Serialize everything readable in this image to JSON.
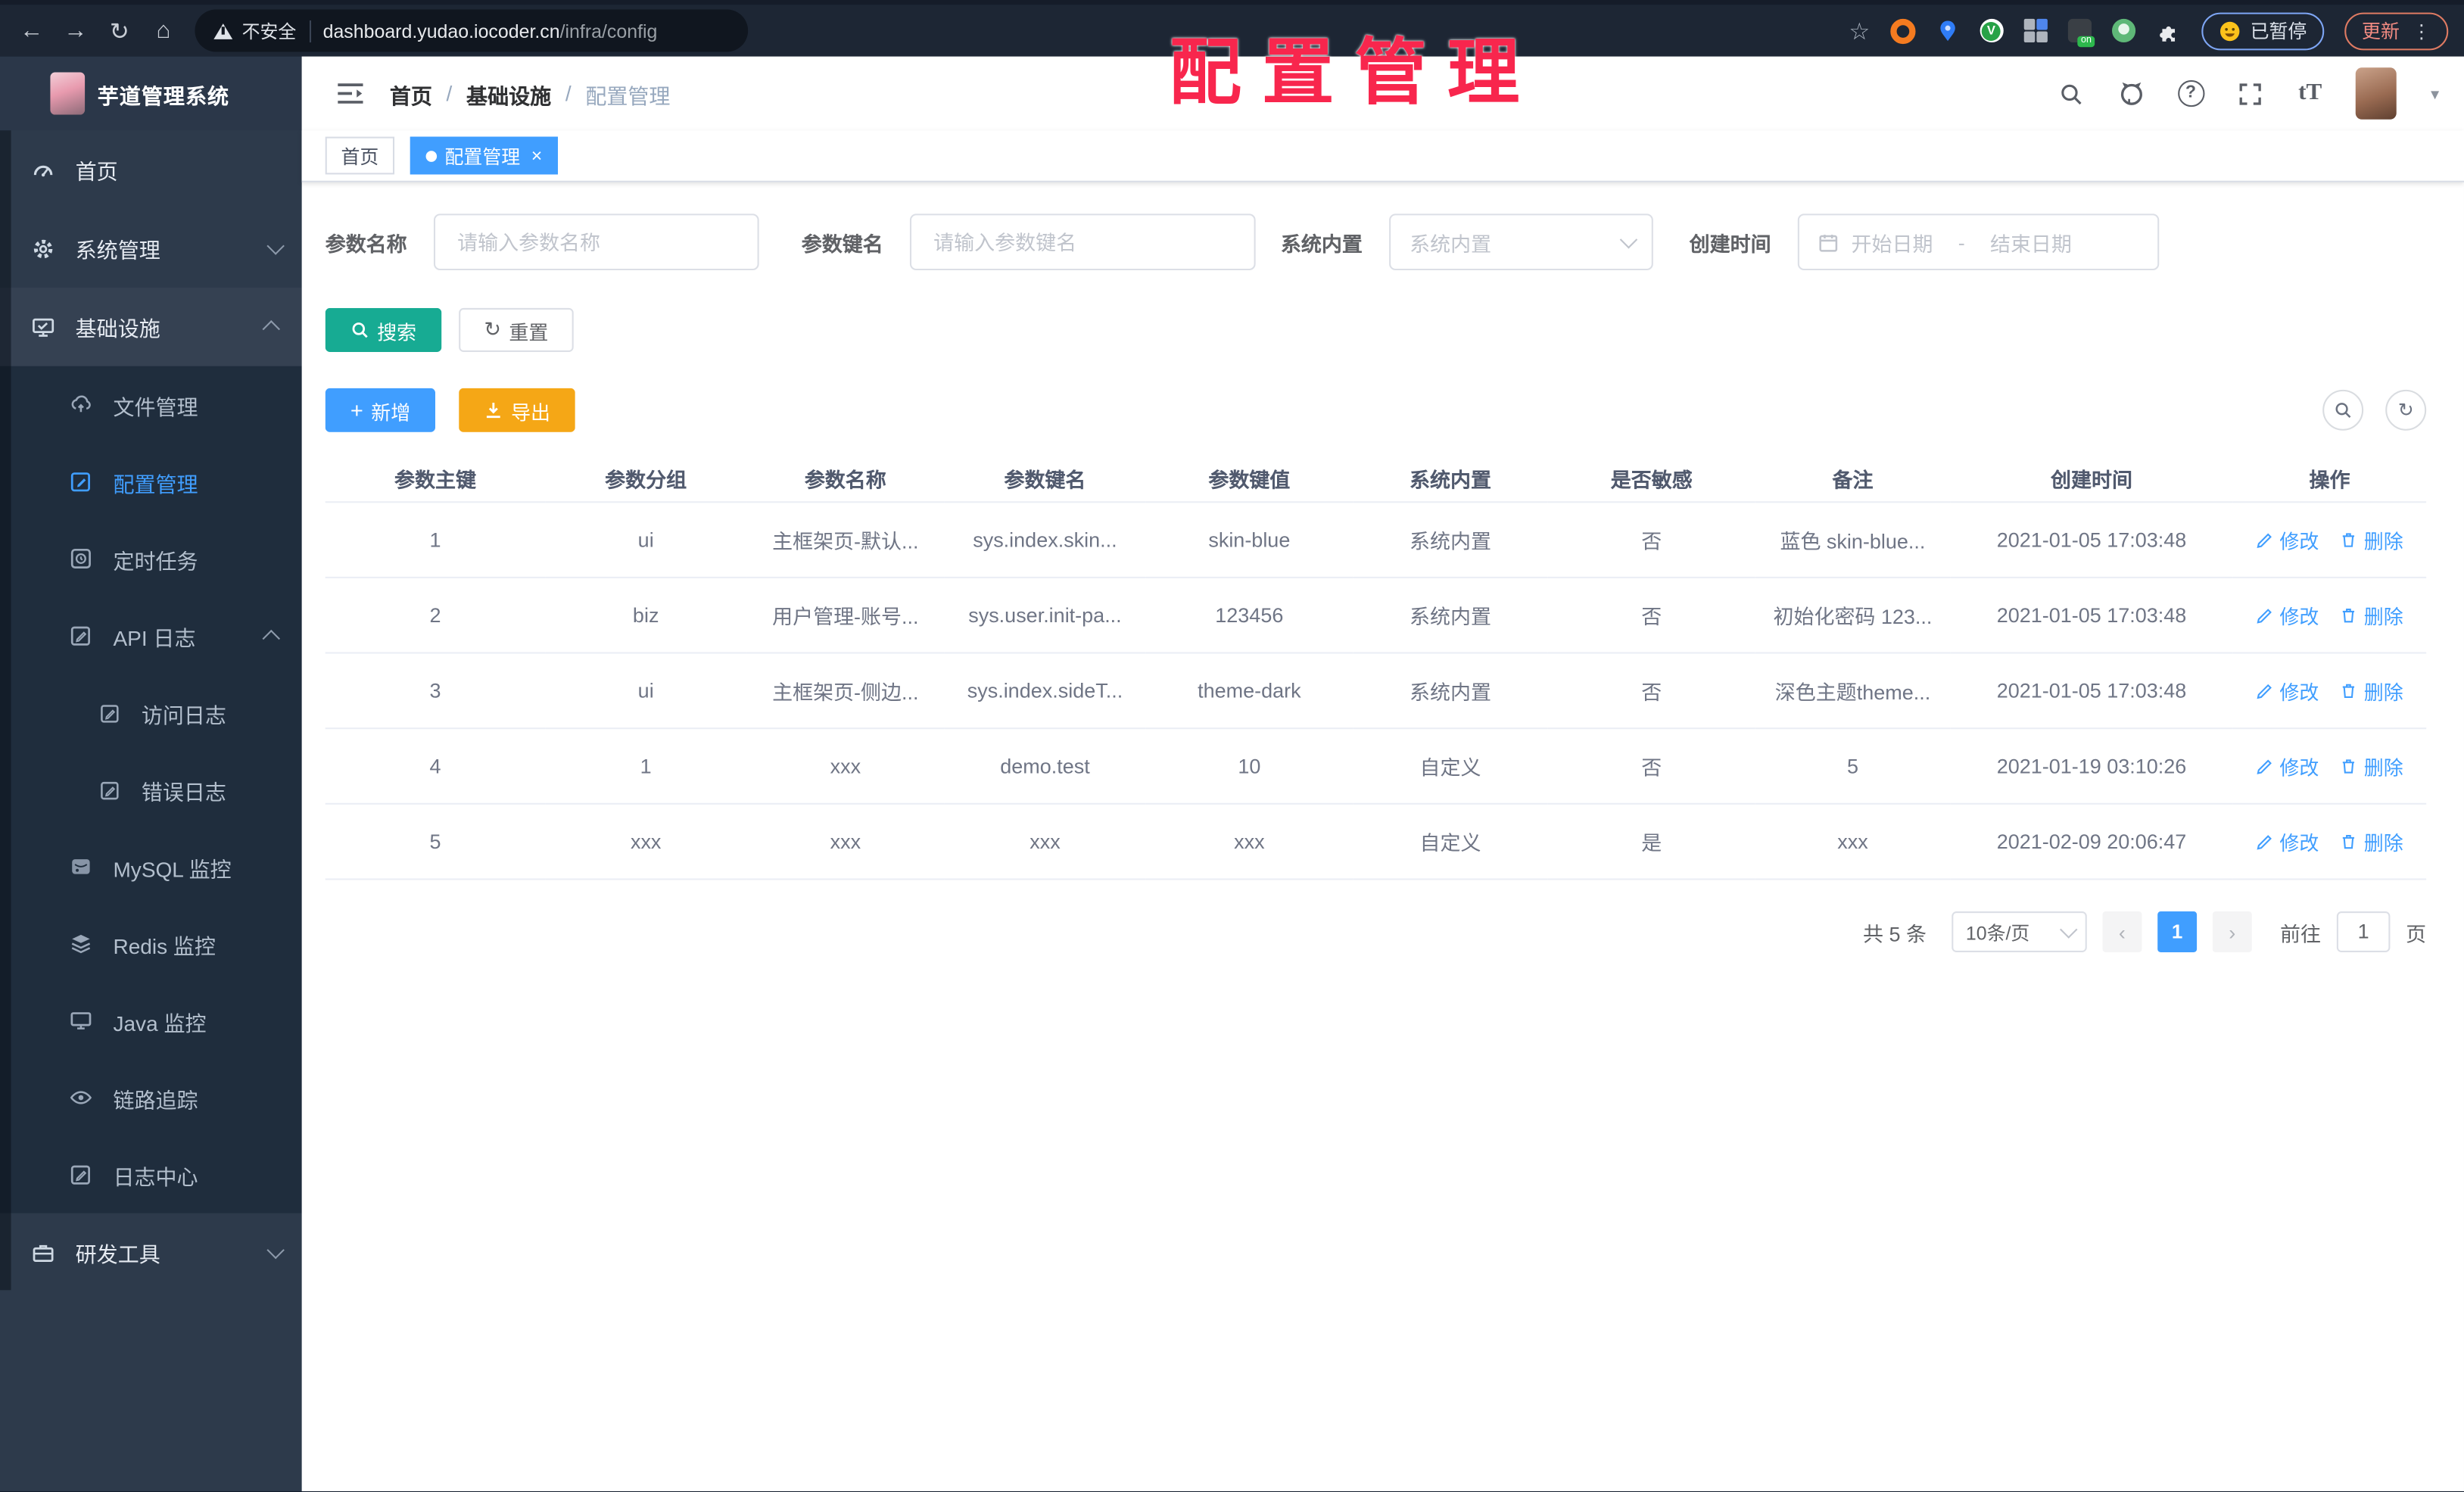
{
  "colors": {
    "accent": "#409eff",
    "search_button": "#17ab93",
    "export_button": "#f5a716",
    "watermark_red": "#f8264d",
    "sidebar_bg": "#2d3a4b",
    "submenu_bg": "#1f2d3d"
  },
  "watermark": "配置管理",
  "browser": {
    "not_secure": "不安全",
    "url_host": "dashboard.yudao.iocoder.cn",
    "url_path": "/infra/config",
    "paused_label": "已暂停",
    "update_label": "更新"
  },
  "sidebar": {
    "title": "芋道管理系统",
    "items": [
      {
        "label": "首页",
        "icon": "dashboard-icon"
      },
      {
        "label": "系统管理",
        "icon": "gear-icon",
        "chevron": "down"
      },
      {
        "label": "基础设施",
        "icon": "infra-monitor-icon",
        "chevron": "up"
      },
      {
        "label": "文件管理",
        "icon": "cloud-upload-icon"
      },
      {
        "label": "配置管理",
        "icon": "edit-square-icon",
        "active": true
      },
      {
        "label": "定时任务",
        "icon": "timer-icon"
      },
      {
        "label": "API 日志",
        "icon": "log-edit-icon",
        "chevron": "up"
      },
      {
        "label": "访问日志",
        "icon": "log-edit-icon"
      },
      {
        "label": "错误日志",
        "icon": "log-edit-icon"
      },
      {
        "label": "MySQL 监控",
        "icon": "database-icon"
      },
      {
        "label": "Redis 监控",
        "icon": "layers-icon"
      },
      {
        "label": "Java 监控",
        "icon": "monitor-icon"
      },
      {
        "label": "链路追踪",
        "icon": "eye-icon"
      },
      {
        "label": "日志中心",
        "icon": "log-edit-icon"
      },
      {
        "label": "研发工具",
        "icon": "briefcase-icon",
        "chevron": "down"
      }
    ]
  },
  "topbar": {
    "breadcrumb": {
      "home": "首页",
      "section": "基础设施",
      "current": "配置管理"
    }
  },
  "tags": {
    "home": "首页",
    "current": "配置管理"
  },
  "filters": {
    "name_label": "参数名称",
    "name_placeholder": "请输入参数名称",
    "key_label": "参数键名",
    "key_placeholder": "请输入参数键名",
    "type_label": "系统内置",
    "type_placeholder": "系统内置",
    "date_label": "创建时间",
    "date_start": "开始日期",
    "date_sep": "-",
    "date_end": "结束日期",
    "search": "搜索",
    "reset": "重置"
  },
  "toolbar": {
    "add": "新增",
    "export": "导出"
  },
  "table": {
    "columns": [
      "参数主键",
      "参数分组",
      "参数名称",
      "参数键名",
      "参数键值",
      "系统内置",
      "是否敏感",
      "备注",
      "创建时间",
      "操作"
    ],
    "rows": [
      {
        "cells": [
          "1",
          "ui",
          "主框架页-默认...",
          "sys.index.skin...",
          "skin-blue",
          "系统内置",
          "否",
          "蓝色 skin-blue...",
          "2021-01-05 17:03:48"
        ],
        "edit": "修改",
        "delete": "删除"
      },
      {
        "cells": [
          "2",
          "biz",
          "用户管理-账号...",
          "sys.user.init-pa...",
          "123456",
          "系统内置",
          "否",
          "初始化密码 123...",
          "2021-01-05 17:03:48"
        ],
        "edit": "修改",
        "delete": "删除"
      },
      {
        "cells": [
          "3",
          "ui",
          "主框架页-侧边...",
          "sys.index.sideT...",
          "theme-dark",
          "系统内置",
          "否",
          "深色主题theme...",
          "2021-01-05 17:03:48"
        ],
        "edit": "修改",
        "delete": "删除"
      },
      {
        "cells": [
          "4",
          "1",
          "xxx",
          "demo.test",
          "10",
          "自定义",
          "否",
          "5",
          "2021-01-19 03:10:26"
        ],
        "edit": "修改",
        "delete": "删除"
      },
      {
        "cells": [
          "5",
          "xxx",
          "xxx",
          "xxx",
          "xxx",
          "自定义",
          "是",
          "xxx",
          "2021-02-09 20:06:47"
        ],
        "edit": "修改",
        "delete": "删除"
      }
    ]
  },
  "pagination": {
    "total": "共 5 条",
    "size": "10条/页",
    "prev": "‹",
    "page": "1",
    "next": "›",
    "goto": "前往",
    "unit": "页"
  }
}
